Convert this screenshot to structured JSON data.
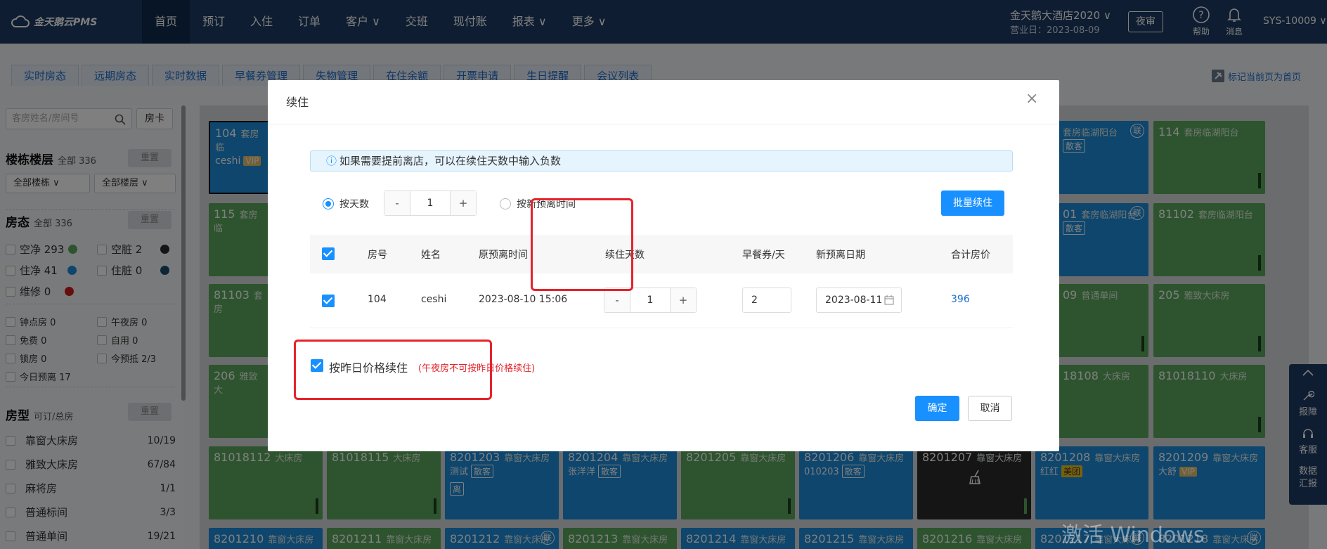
{
  "app": {
    "logo_text": "金天鹅云PMS"
  },
  "nav": [
    "首页",
    "预订",
    "入住",
    "订单",
    "客户 ∨",
    "交班",
    "现付账",
    "报表 ∨",
    "更多 ∨"
  ],
  "hotel": {
    "name": "金天鹅大酒店2020 ∨",
    "business_day": "营业日：2023-08-09",
    "night_audit": "夜审"
  },
  "top_icons": {
    "help": "帮助",
    "message": "消息"
  },
  "user": "SYS-10009 ∨",
  "tabs": [
    "实时房态",
    "远期房态",
    "实时数据",
    "早餐券管理",
    "失物管理",
    "在住余额",
    "开票申请",
    "生日提醒",
    "会议列表"
  ],
  "pin_label": "标记当前页为首页",
  "sidebar": {
    "search_placeholder": "客房姓名/房间号",
    "room_card": "房卡",
    "building": {
      "title": "楼栋楼层",
      "sub": "全部 336",
      "reset": "重置",
      "sel_building": "全部楼栋 ∨",
      "sel_floor": "全部楼层 ∨"
    },
    "status": {
      "title": "房态",
      "sub": "全部 336",
      "reset": "重置",
      "items": [
        {
          "label": "空净 293",
          "color": "#5ba85c"
        },
        {
          "label": "空脏 2",
          "color": "#2b2b2b"
        },
        {
          "label": "住净 41",
          "color": "#1c8ddb"
        },
        {
          "label": "住脏 0",
          "color": "#1c4a6a"
        },
        {
          "label": "维修 0",
          "color": "#d11a1a"
        }
      ]
    },
    "flags": [
      "钟点房 0",
      "午夜房 0",
      "免费 0",
      "自用 0",
      "锁房 0",
      "今预抵 2/3",
      "今日预离 17"
    ],
    "roomtype": {
      "title": "房型",
      "sub": "可订/总房",
      "reset": "重置",
      "items": [
        {
          "name": "靠窗大床房",
          "count": "10/19"
        },
        {
          "name": "雅致大床房",
          "count": "67/84"
        },
        {
          "name": "麻将房",
          "count": "1/1"
        },
        {
          "name": "普通标间",
          "count": "3/3"
        },
        {
          "name": "普通单间",
          "count": "19/21"
        }
      ]
    }
  },
  "rooms": {
    "r104": {
      "no": "104",
      "type": "套房临",
      "guest": "ceshi",
      "vip": "VIP"
    },
    "r115": {
      "no": "115",
      "type": "套房临"
    },
    "r81103": {
      "no": "81103",
      "type": "套房"
    },
    "r206": {
      "no": "206",
      "type": "雅致大"
    },
    "rA": {
      "type": "套房临湖阳台",
      "tag": "散客",
      "lian": "联"
    },
    "r114": {
      "no": "114",
      "type": "套房临湖阳台"
    },
    "rB": {
      "no": "01",
      "type": "套房临湖阳台",
      "tag": "散客",
      "lian": "联"
    },
    "r81102": {
      "no": "81102",
      "type": "套房临湖阳台"
    },
    "rC": {
      "no": "09",
      "type": "普通单间"
    },
    "r205": {
      "no": "205",
      "type": "雅致大床房"
    },
    "rD": {
      "no": "18108",
      "type": "大床房"
    },
    "r81018110": {
      "no": "81018110",
      "type": "大床房"
    },
    "row5": [
      {
        "no": "81018112",
        "type": "大床房"
      },
      {
        "no": "81018115",
        "type": "大床房"
      },
      {
        "no": "8201203",
        "type": "靠窗大床房",
        "guest": "测试",
        "tag": "散客",
        "extra": "离"
      },
      {
        "no": "8201204",
        "type": "靠窗大床房",
        "guest": "张洋洋",
        "tag": "散客"
      },
      {
        "no": "8201205",
        "type": "靠窗大床房"
      },
      {
        "no": "8201206",
        "type": "靠窗大床房",
        "guest": "010203",
        "tag": "散客"
      },
      {
        "no": "8201207",
        "type": "靠窗大床房"
      },
      {
        "no": "8201208",
        "type": "靠窗大床房",
        "guest": "红红",
        "tag": "美团"
      },
      {
        "no": "8201209",
        "type": "靠窗大床房",
        "guest": "大舒",
        "vip": "VIP"
      }
    ],
    "row6": [
      {
        "no": "8201210",
        "type": "靠窗大床房"
      },
      {
        "no": "8201211",
        "type": "靠窗大床房"
      },
      {
        "no": "8201212",
        "type": "靠窗大床房",
        "lian": "联"
      },
      {
        "no": "8201213",
        "type": "靠窗大床房"
      },
      {
        "no": "8201214",
        "type": "靠窗大床房"
      },
      {
        "no": "8201215",
        "type": "靠窗大床房"
      },
      {
        "no": "8201216",
        "type": "靠窗大床房"
      },
      {
        "no": "8201217",
        "type": "靠窗大床房",
        "lian": "联"
      },
      {
        "no": "8201218",
        "type": "靠窗大床房",
        "lian": "联"
      }
    ]
  },
  "dock": {
    "fault": "报障",
    "service": "客服",
    "data": "数据汇报"
  },
  "watermark": "激活 Windows",
  "modal": {
    "title": "续住",
    "close": "×",
    "notice": "如果需要提前离店，可以在续住天数中输入负数",
    "mode_days": "按天数",
    "mode_time": "按新预离时间",
    "days_value": "1",
    "batch_button": "批量续住",
    "columns": [
      "房号",
      "姓名",
      "原预离时间",
      "续住天数",
      "早餐券/天",
      "新预离日期",
      "合计房价"
    ],
    "row": {
      "room": "104",
      "name": "ceshi",
      "orig_departure": "2023-08-10 15:06",
      "days": "1",
      "breakfast": "2",
      "new_departure": "2023-08-11",
      "total": "396"
    },
    "yesterday_price": "按昨日价格续住",
    "yesterday_note": "(午夜房不可按昨日价格续住)",
    "confirm": "确定",
    "cancel": "取消"
  }
}
